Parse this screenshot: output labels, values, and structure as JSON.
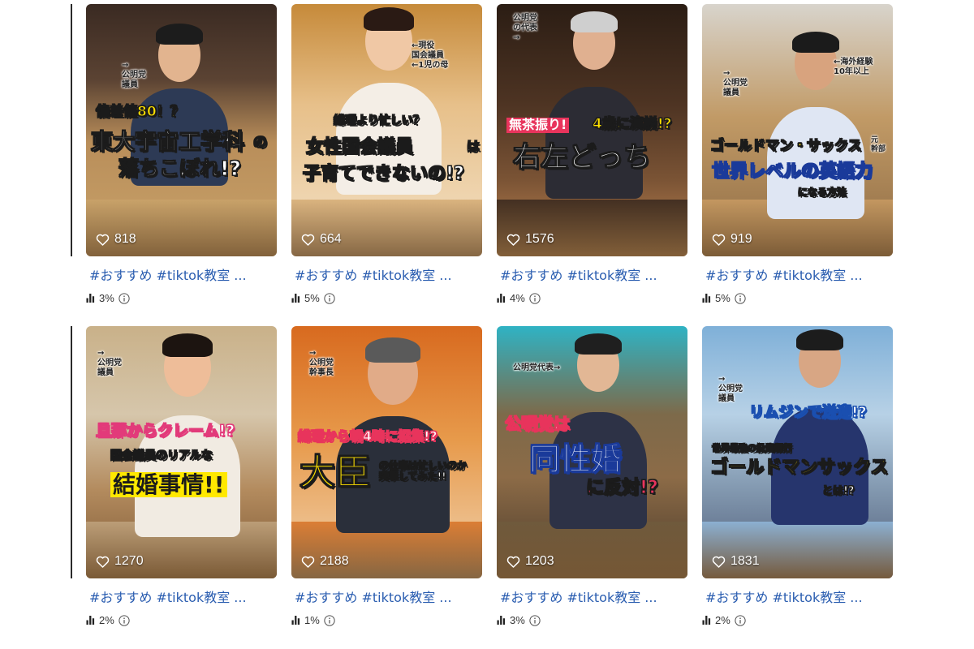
{
  "videos": [
    {
      "likes": "818",
      "caption": "#おすすめ #tiktok教室 ...",
      "rate": "3%",
      "overlay": {
        "tag": "偏差値80！？",
        "title": "東大宇宙工学科",
        "suffix": "の",
        "title2": "落ちこぼれ!?",
        "note": "→\n公明党\n議員"
      },
      "colors": {
        "bg": "#c9a36a",
        "accent": "#ffd400",
        "title": "#ffffff"
      }
    },
    {
      "likes": "664",
      "caption": "#おすすめ #tiktok教室 ...",
      "rate": "5%",
      "overlay": {
        "tag": "総理より忙しい？",
        "title": "女性国会議員",
        "suffix": "は",
        "title2": "子育てできないの!?",
        "note": "←現役\n国会議員\n←1児の母"
      },
      "colors": {
        "bg": "#d8b07a",
        "accent": "#ffd400",
        "title": "#ffffff"
      }
    },
    {
      "likes": "1576",
      "caption": "#おすすめ #tiktok教室 ...",
      "rate": "4%",
      "overlay": {
        "tag": "無茶振り!",
        "tag2": "4歳に演説!?",
        "title": "右左どっち",
        "note": "公明党\nの代表\n→"
      },
      "colors": {
        "bg": "#3b2a1f",
        "accent": "#e8345c",
        "title": "#ffffff"
      }
    },
    {
      "likes": "919",
      "caption": "#おすすめ #tiktok教室 ...",
      "rate": "5%",
      "overlay": {
        "tag": "ゴールドマン・サックス",
        "tag_small": "元\n幹部",
        "title": "世界レベルの英語力",
        "title2": "になる方法",
        "note": "→\n公明党\n議員",
        "note2": "←海外経験\n10年以上"
      },
      "colors": {
        "bg": "#c79a62",
        "accent": "#ffd400",
        "title": "#ffffff"
      }
    },
    {
      "likes": "1270",
      "caption": "#おすすめ #tiktok教室 ...",
      "rate": "2%",
      "overlay": {
        "tag": "旦那からクレーム!?",
        "title": "国会議員のリアルな",
        "title2": "結婚事情!!",
        "note": "→\n公明党\n議員"
      },
      "colors": {
        "bg": "#bfa27c",
        "accent": "#ffe800",
        "title": "#ffffff"
      }
    },
    {
      "likes": "2188",
      "caption": "#おすすめ #tiktok教室 ...",
      "rate": "1%",
      "overlay": {
        "tag": "総理から朝4時に招集!?",
        "title": "大臣",
        "title2": "の仕事は忙しいのか\n突撃してみた!!",
        "note": "→\n公明党\n幹事長"
      },
      "colors": {
        "bg": "#d9772c",
        "accent": "#ffd400",
        "title": "#ffffff"
      }
    },
    {
      "likes": "1203",
      "caption": "#おすすめ #tiktok教室 ...",
      "rate": "3%",
      "overlay": {
        "tag": "公明党は",
        "title": "同性婚",
        "title2": "に反対!?",
        "note": "公明党代表→"
      },
      "colors": {
        "bg": "#6f5a3c",
        "accent": "#e8345c",
        "title": "#ffffff"
      }
    },
    {
      "likes": "1831",
      "caption": "#おすすめ #tiktok教室 ...",
      "rate": "2%",
      "overlay": {
        "tag": "リムジンで送迎!?",
        "title": "世界最強の投資銀行",
        "title2": "ゴールドマンサックス",
        "title3": "とは!?",
        "note": "→\n公明党\n議員"
      },
      "colors": {
        "bg": "#8fb5d8",
        "accent": "#ffd400",
        "title": "#ffffff"
      }
    }
  ]
}
